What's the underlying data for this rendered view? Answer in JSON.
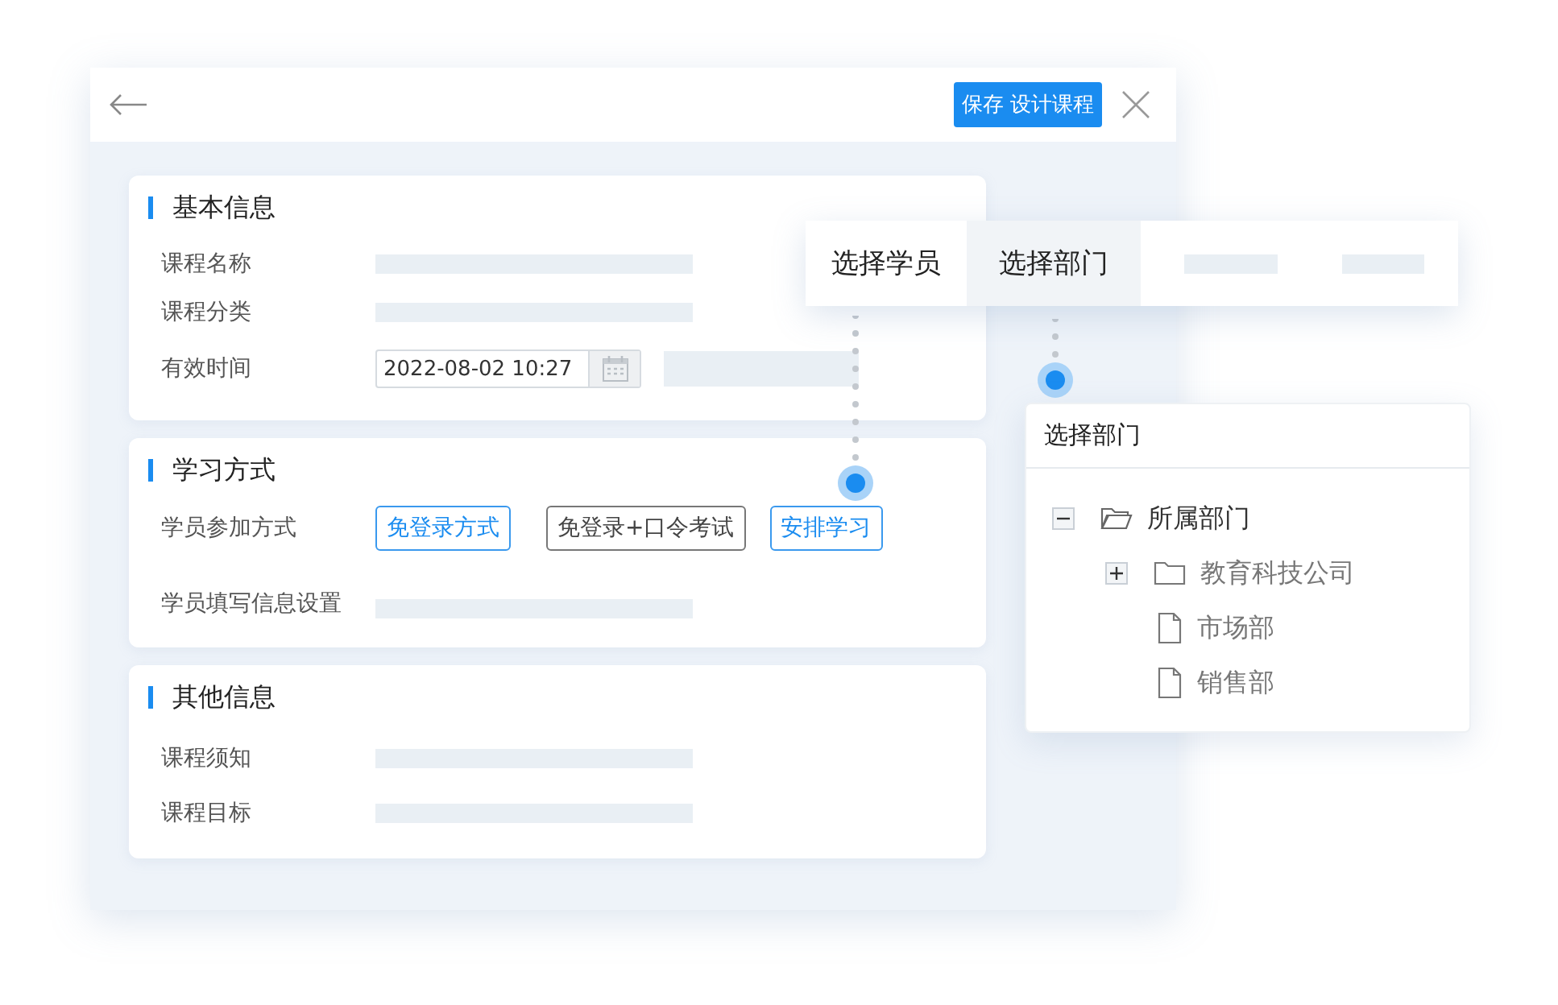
{
  "window": {
    "save_button": "保存 设计课程"
  },
  "sections": [
    {
      "title": "基本信息",
      "fields": [
        {
          "label": "课程名称",
          "kind": "bar"
        },
        {
          "label": "课程分类",
          "kind": "bar"
        },
        {
          "label": "有效时间",
          "kind": "date",
          "value": "2022-08-02 10:27"
        }
      ]
    },
    {
      "title": "学习方式",
      "fields": [
        {
          "label": "学员参加方式",
          "kind": "options",
          "options": [
            {
              "label": "免登录方式",
              "selected": true
            },
            {
              "label": "免登录+口令考试",
              "selected": false
            },
            {
              "label": "安排学习",
              "selected": true
            }
          ]
        },
        {
          "label": "学员填写信息设置",
          "kind": "bar"
        }
      ]
    },
    {
      "title": "其他信息",
      "fields": [
        {
          "label": "课程须知",
          "kind": "bar"
        },
        {
          "label": "课程目标",
          "kind": "bar"
        }
      ]
    }
  ],
  "tab_panel": {
    "tabs": [
      {
        "label": "选择学员",
        "selected": false
      },
      {
        "label": "选择部门",
        "selected": true
      }
    ]
  },
  "tree": {
    "title": "选择部门",
    "items": [
      {
        "label": "所属部门",
        "kind": "folder",
        "expanded": true,
        "children": [
          {
            "label": "教育科技公司",
            "kind": "folder",
            "expanded": false
          },
          {
            "label": "市场部",
            "kind": "file"
          },
          {
            "label": "销售部",
            "kind": "file"
          }
        ]
      }
    ]
  }
}
